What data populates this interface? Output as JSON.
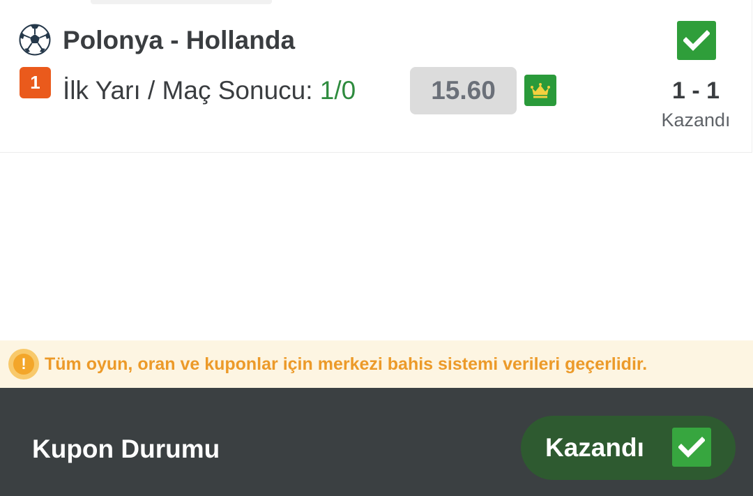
{
  "match": {
    "title": "Polonya - Hollanda",
    "ball_icon": "soccer-ball-icon",
    "status_icon": "check-icon",
    "rank_badge": "1",
    "bet_type_label": "İlk Yarı / Maç Sonucu:",
    "bet_choice": "1/0",
    "odds": "15.60",
    "crown_icon": "crown-icon",
    "score": "1 - 1",
    "result_label": "Kazandı"
  },
  "info_banner": {
    "icon": "warning-icon",
    "text": "Tüm oyun, oran ve kuponlar için merkezi bahis sistemi verileri geçerlidir."
  },
  "footer": {
    "label": "Kupon Durumu",
    "status_label": "Kazandı",
    "status_icon": "check-icon"
  },
  "colors": {
    "win_green": "#2f9e3a",
    "bet_choice_green": "#2e8b3e",
    "badge_orange": "#ea5a1c",
    "warning_text": "#ec9a29",
    "footer_bg": "#3b4042",
    "pill_bg": "#2e5a30"
  }
}
